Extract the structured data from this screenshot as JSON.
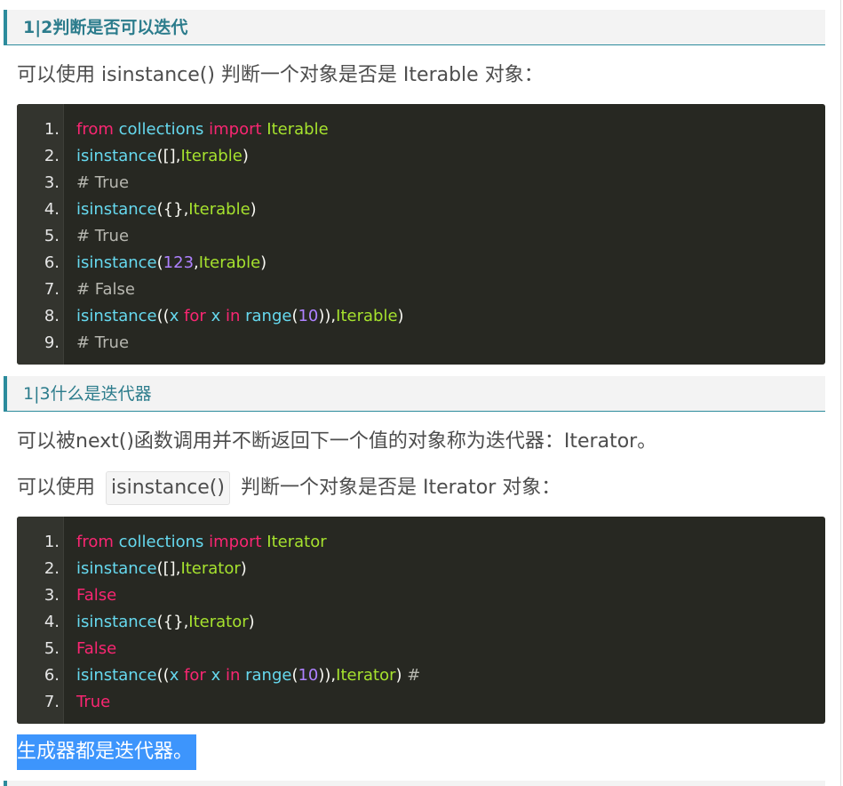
{
  "section1": {
    "heading": "1|2判断是否可以迭代",
    "intro": "可以使用 isinstance() 判断一个对象是否是 Iterable 对象："
  },
  "code1": {
    "lines": [
      {
        "no": "1.",
        "tokens": [
          [
            "kw",
            "from"
          ],
          [
            "pn",
            " "
          ],
          [
            "fn",
            "collections"
          ],
          [
            "pn",
            " "
          ],
          [
            "kw",
            "import"
          ],
          [
            "pn",
            " "
          ],
          [
            "cls",
            "Iterable"
          ]
        ]
      },
      {
        "no": "2.",
        "tokens": [
          [
            "fn",
            "isinstance"
          ],
          [
            "pn",
            "([],"
          ],
          [
            "cls",
            "Iterable"
          ],
          [
            "pn",
            ")"
          ]
        ]
      },
      {
        "no": "3.",
        "tokens": [
          [
            "cm",
            "# True"
          ]
        ]
      },
      {
        "no": "4.",
        "tokens": [
          [
            "fn",
            "isinstance"
          ],
          [
            "pn",
            "({},"
          ],
          [
            "cls",
            "Iterable"
          ],
          [
            "pn",
            ")"
          ]
        ]
      },
      {
        "no": "5.",
        "tokens": [
          [
            "cm",
            "# True"
          ]
        ]
      },
      {
        "no": "6.",
        "tokens": [
          [
            "fn",
            "isinstance"
          ],
          [
            "pn",
            "("
          ],
          [
            "num",
            "123"
          ],
          [
            "pn",
            ","
          ],
          [
            "cls",
            "Iterable"
          ],
          [
            "pn",
            ")"
          ]
        ]
      },
      {
        "no": "7.",
        "tokens": [
          [
            "cm",
            "# False"
          ]
        ]
      },
      {
        "no": "8.",
        "tokens": [
          [
            "fn",
            "isinstance"
          ],
          [
            "pn",
            "(("
          ],
          [
            "fn",
            "x"
          ],
          [
            "pn",
            " "
          ],
          [
            "kw",
            "for"
          ],
          [
            "pn",
            " "
          ],
          [
            "fn",
            "x"
          ],
          [
            "pn",
            " "
          ],
          [
            "kw",
            "in"
          ],
          [
            "pn",
            " "
          ],
          [
            "fn",
            "range"
          ],
          [
            "pn",
            "("
          ],
          [
            "num",
            "10"
          ],
          [
            "pn",
            ")),"
          ],
          [
            "cls",
            "Iterable"
          ],
          [
            "pn",
            ")"
          ]
        ]
      },
      {
        "no": "9.",
        "tokens": [
          [
            "cm",
            "# True"
          ]
        ]
      }
    ]
  },
  "section2": {
    "heading": "1|3什么是迭代器",
    "para1": "可以被next()函数调用并不断返回下一个值的对象称为迭代器：Iterator。",
    "para2_before": "可以使用",
    "para2_code": "isinstance()",
    "para2_after": "判断一个对象是否是 Iterator 对象："
  },
  "code2": {
    "lines": [
      {
        "no": "1.",
        "tokens": [
          [
            "kw",
            "from"
          ],
          [
            "pn",
            " "
          ],
          [
            "fn",
            "collections"
          ],
          [
            "pn",
            " "
          ],
          [
            "kw",
            "import"
          ],
          [
            "pn",
            " "
          ],
          [
            "cls",
            "Iterator"
          ]
        ]
      },
      {
        "no": "2.",
        "tokens": [
          [
            "fn",
            "isinstance"
          ],
          [
            "pn",
            "([],"
          ],
          [
            "cls",
            "Iterator"
          ],
          [
            "pn",
            ")"
          ]
        ]
      },
      {
        "no": "3.",
        "tokens": [
          [
            "kw",
            "False"
          ]
        ]
      },
      {
        "no": "4.",
        "tokens": [
          [
            "fn",
            "isinstance"
          ],
          [
            "pn",
            "({},"
          ],
          [
            "cls",
            "Iterator"
          ],
          [
            "pn",
            ")"
          ]
        ]
      },
      {
        "no": "5.",
        "tokens": [
          [
            "kw",
            "False"
          ]
        ]
      },
      {
        "no": "6.",
        "tokens": [
          [
            "fn",
            "isinstance"
          ],
          [
            "pn",
            "(("
          ],
          [
            "fn",
            "x"
          ],
          [
            "pn",
            " "
          ],
          [
            "kw",
            "for"
          ],
          [
            "pn",
            " "
          ],
          [
            "fn",
            "x"
          ],
          [
            "pn",
            " "
          ],
          [
            "kw",
            "in"
          ],
          [
            "pn",
            " "
          ],
          [
            "fn",
            "range"
          ],
          [
            "pn",
            "("
          ],
          [
            "num",
            "10"
          ],
          [
            "pn",
            ")),"
          ],
          [
            "cls",
            "Iterator"
          ],
          [
            "pn",
            ") "
          ],
          [
            "cm",
            "#"
          ]
        ]
      },
      {
        "no": "7.",
        "tokens": [
          [
            "kw",
            "True"
          ]
        ]
      }
    ]
  },
  "highlight": "生成器都是迭代器。"
}
